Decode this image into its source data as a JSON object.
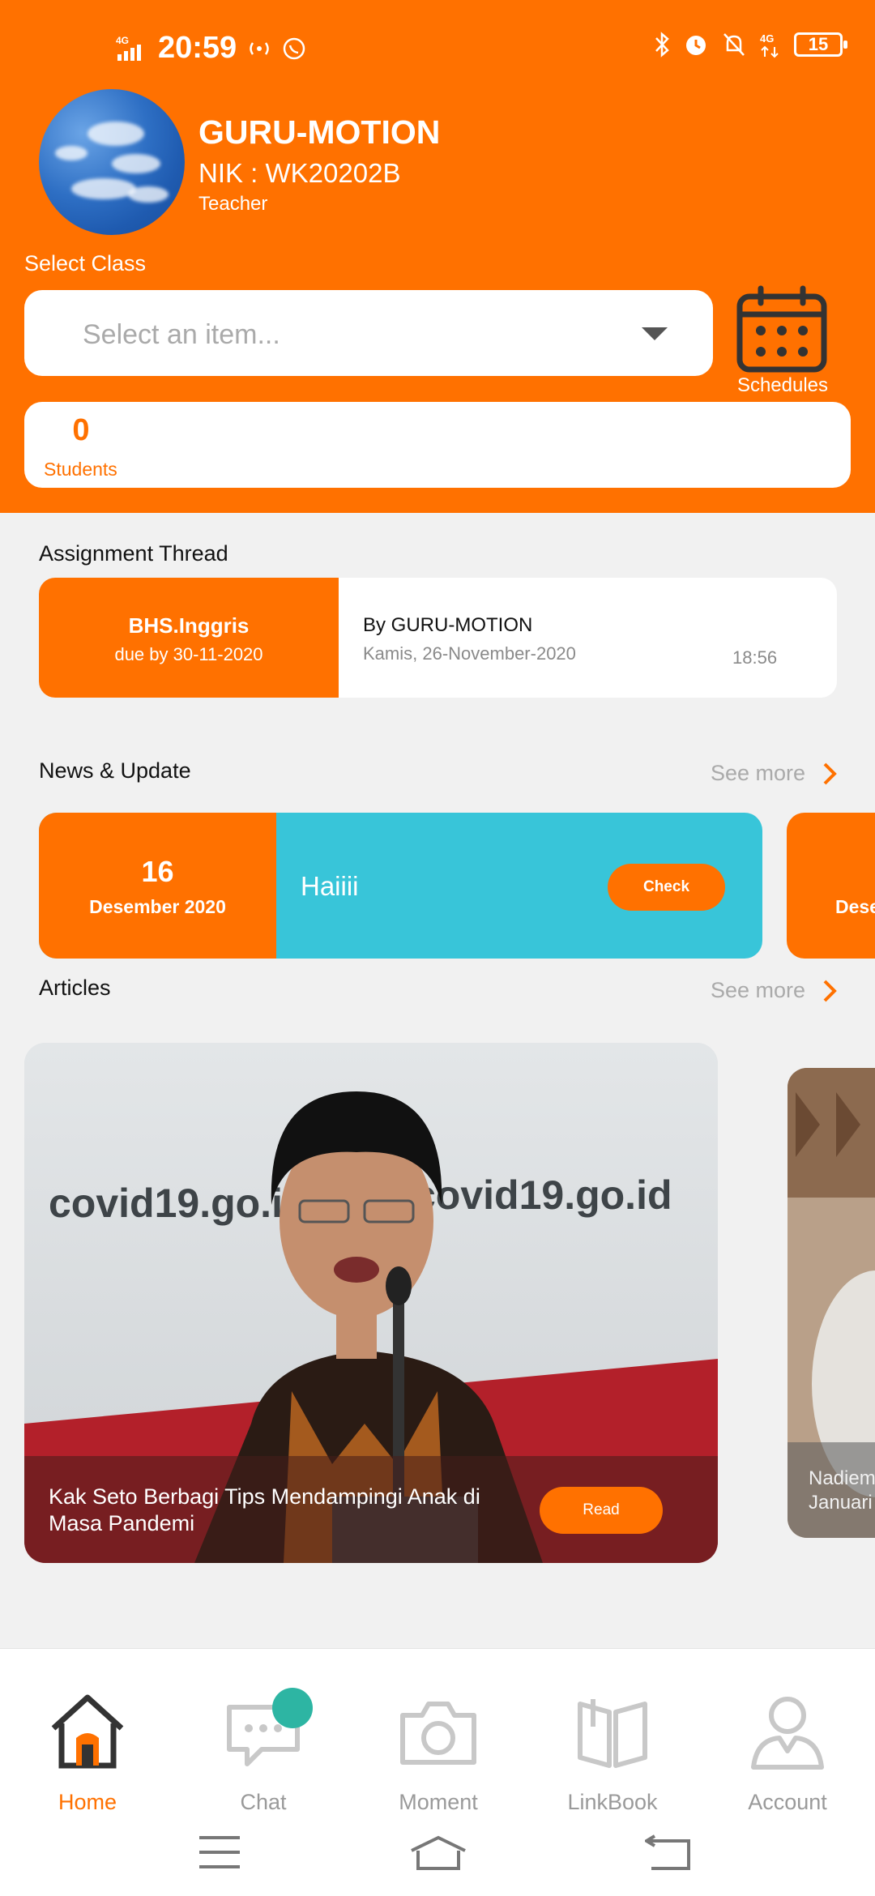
{
  "status_bar": {
    "time": "20:59",
    "network": "4G",
    "battery": "15"
  },
  "profile": {
    "name": "GURU-MOTION",
    "nik": "NIK : WK20202B",
    "role": "Teacher"
  },
  "class_select": {
    "label": "Select Class",
    "placeholder": "Select an item..."
  },
  "schedules": {
    "label": "Schedules"
  },
  "students": {
    "count": "0",
    "label": "Students"
  },
  "assignment": {
    "section_title": "Assignment Thread",
    "subject": "BHS.Inggris",
    "due": "due by 30-11-2020",
    "by": "By GURU-MOTION",
    "date": "Kamis, 26-November-2020",
    "time": "18:56"
  },
  "news": {
    "section_title": "News & Update",
    "see_more": "See more",
    "items": [
      {
        "day": "16",
        "month": "Desember 2020",
        "title": "Haiiii",
        "button": "Check"
      },
      {
        "month_partial": "Dese"
      }
    ]
  },
  "articles": {
    "section_title": "Articles",
    "see_more": "See more",
    "items": [
      {
        "title": "Kak Seto Berbagi Tips Mendampingi Anak di Masa Pandemi",
        "button": "Read",
        "image_text": "covid19.go.id"
      },
      {
        "title_partial_1": "Nadiem",
        "title_partial_2": "Januari"
      }
    ]
  },
  "bottom_nav": {
    "items": [
      {
        "label": "Home",
        "icon": "home-icon"
      },
      {
        "label": "Chat",
        "icon": "chat-icon"
      },
      {
        "label": "Moment",
        "icon": "camera-icon"
      },
      {
        "label": "LinkBook",
        "icon": "book-icon"
      },
      {
        "label": "Account",
        "icon": "person-icon"
      }
    ]
  },
  "colors": {
    "accent": "#ff7100",
    "news_bg": "#38c5d9",
    "background": "#f1f1f1",
    "badge": "#2db5a3"
  }
}
